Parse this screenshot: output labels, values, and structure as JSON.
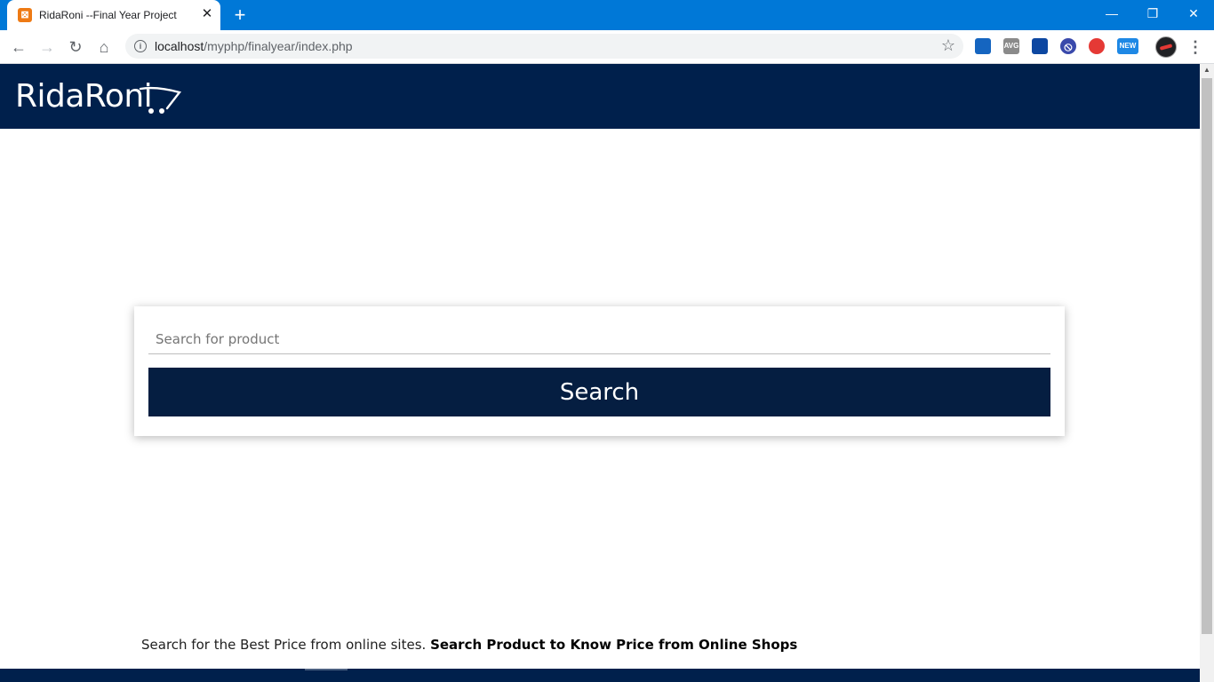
{
  "browser": {
    "tab_title": "RidaRoni --Final Year Project",
    "tab_close": "✕",
    "new_tab": "+",
    "window_controls": {
      "minimize": "—",
      "restore": "❐",
      "close": "✕"
    },
    "nav": {
      "back": "←",
      "forward": "→",
      "reload": "↻",
      "home": "⌂"
    },
    "url_host": "localhost",
    "url_path": "/myphp/finalyear/index.php",
    "bookmark_star": "☆",
    "extensions": [
      {
        "name": "toolbox-extension-icon",
        "label": "",
        "color": "#1565c0"
      },
      {
        "name": "avg-extension-icon",
        "label": "AVG",
        "color": "#8a8a8a"
      },
      {
        "name": "analytics-extension-icon",
        "label": "",
        "color": "#0d47a1"
      },
      {
        "name": "block-extension-icon",
        "label": "⦸",
        "color": "#3949ab"
      },
      {
        "name": "adblock-extension-icon",
        "label": "",
        "color": "#e53935"
      },
      {
        "name": "new-extension-icon",
        "label": "NEW",
        "color": "#1e88e5"
      }
    ],
    "menu": "⋮"
  },
  "site": {
    "logo": "RidaRoni",
    "search": {
      "placeholder": "Search for product",
      "value": "",
      "button_label": "Search"
    },
    "footer": {
      "text": "Search for the Best Price from online sites.",
      "bold_text": "Search Product to Know Price from Online Shops"
    }
  },
  "colors": {
    "titlebar": "#0078d7",
    "header": "#00204c",
    "search_button": "#051e41"
  }
}
